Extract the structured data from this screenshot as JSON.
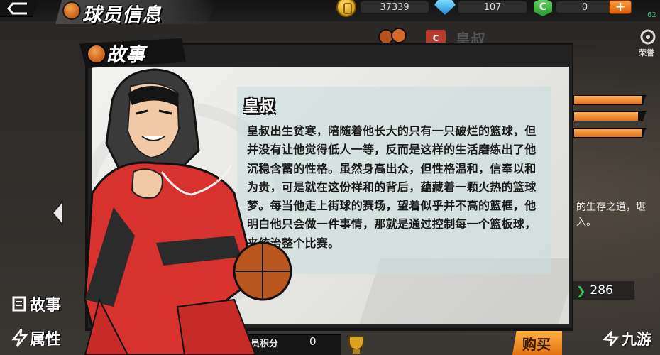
{
  "header": {
    "page_title": "球员信息",
    "back_icon": "back-arrow-icon"
  },
  "currencies": {
    "coins": "37339",
    "gems": "107",
    "c_points": "0",
    "c_label": "C",
    "plus_label": "+",
    "corner_value": "62"
  },
  "background": {
    "player_name": "皇叔",
    "badge_label": "C",
    "side_text": "的生存之道，堪\n入。",
    "value_286": "286",
    "right_button_label": "荣誉",
    "bar_fills": [
      0.95,
      0.9,
      0.95
    ]
  },
  "side_nav": {
    "tabs": [
      {
        "label": "故事",
        "icon": "story-book-icon"
      },
      {
        "label": "属性",
        "icon": "lightning-icon"
      }
    ]
  },
  "bottom": {
    "score_label": "球员积分",
    "score_value": "0",
    "buy_label": "购买"
  },
  "modal": {
    "title": "故事",
    "character_name": "皇叔",
    "story": "皇叔出生贫寒，陪随着他长大的只有一只破烂的篮球，但并没有让他觉得低人一等，反而是这样的生活磨练出了他沉稳含蓄的性格。虽然身高出众，但性格温和，信奉以和为贵，可是就在这份祥和的背后，蕴藏着一颗火热的篮球梦。每当他走上街球的赛场，望着似乎并不高的篮框，他明白他只会做一件事情，那就是通过控制每一个篮板球，来统治整个比赛。"
  },
  "watermark": {
    "text": "九游"
  },
  "colors": {
    "accent_orange": "#e2740f",
    "modal_bg": "#e8e8e5",
    "text_panel": "#c8dede",
    "jacket_red": "#d8322e"
  }
}
